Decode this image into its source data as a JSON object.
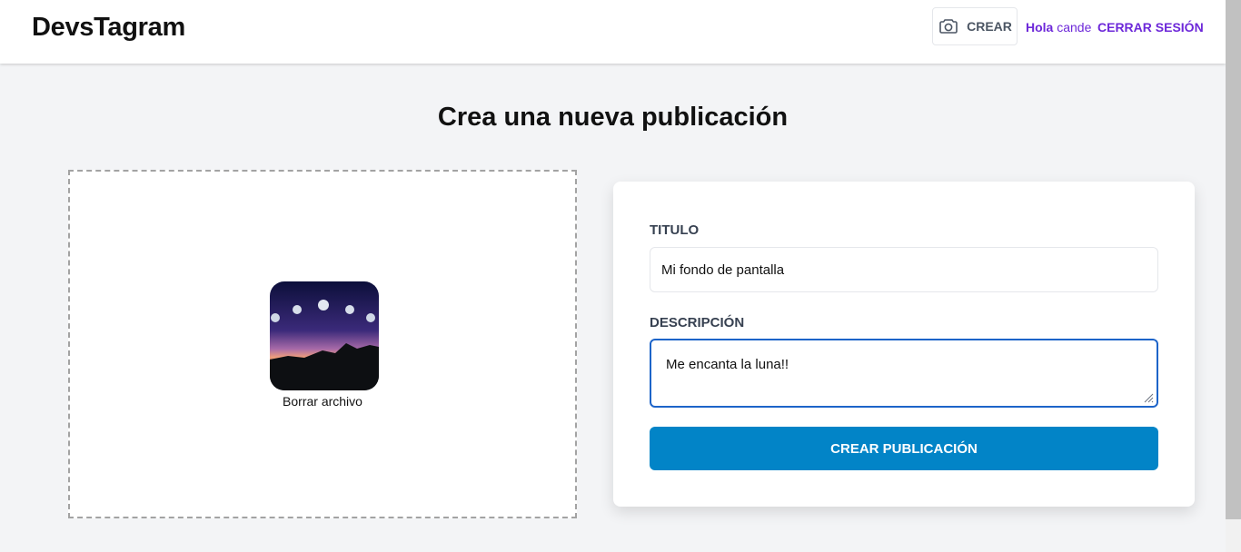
{
  "header": {
    "brand": "DevsTagram",
    "create_label": "CREAR",
    "greeting_prefix": "Hola",
    "username": "cande",
    "logout_label": "CERRAR SESIÓN"
  },
  "page": {
    "title": "Crea una nueva publicación"
  },
  "dropzone": {
    "remove_label": "Borrar archivo"
  },
  "form": {
    "title_label": "TITULO",
    "title_value": "Mi fondo de pantalla",
    "description_label": "DESCRIPCIÓN",
    "description_value": "Me encanta la luna!!",
    "submit_label": "CREAR PUBLICACIÓN"
  },
  "colors": {
    "accent": "#6d28d9",
    "submit": "#0284c7",
    "focus": "#1d64c9"
  },
  "icons": {
    "create": "camera-icon",
    "resize": "resize-handle-icon"
  }
}
